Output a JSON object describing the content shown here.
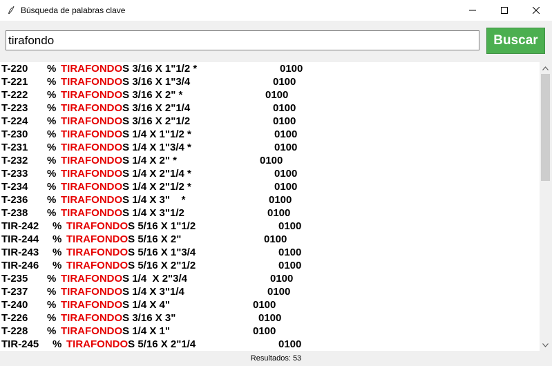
{
  "window": {
    "title": "Búsqueda de palabras clave",
    "app_icon": "feather-icon",
    "controls": [
      "minimize-icon",
      "maximize-icon",
      "close-icon"
    ]
  },
  "search": {
    "value": "tirafondo",
    "button_label": "Buscar",
    "button_color": "#4caf50"
  },
  "colors": {
    "keyword": "#e60000"
  },
  "results": [
    {
      "code": "T-220",
      "pct": "%",
      "kw": "TIRAFONDO",
      "rest": "S 3/16 X 1\"1/2 *",
      "qty": "0100"
    },
    {
      "code": "T-221",
      "pct": "%",
      "kw": "TIRAFONDO",
      "rest": "S 3/16 X 1\"3/4",
      "qty": "0100"
    },
    {
      "code": "T-222",
      "pct": "%",
      "kw": "TIRAFONDO",
      "rest": "S 3/16 X 2\" *",
      "qty": "0100"
    },
    {
      "code": "T-223",
      "pct": "%",
      "kw": "TIRAFONDO",
      "rest": "S 3/16 X 2\"1/4",
      "qty": "0100"
    },
    {
      "code": "T-224",
      "pct": "%",
      "kw": "TIRAFONDO",
      "rest": "S 3/16 X 2\"1/2",
      "qty": "0100"
    },
    {
      "code": "T-230",
      "pct": "%",
      "kw": "TIRAFONDO",
      "rest": "S 1/4 X 1\"1/2 *",
      "qty": "0100"
    },
    {
      "code": "T-231",
      "pct": "%",
      "kw": "TIRAFONDO",
      "rest": "S 1/4 X 1\"3/4 *",
      "qty": "0100"
    },
    {
      "code": "T-232",
      "pct": "%",
      "kw": "TIRAFONDO",
      "rest": "S 1/4 X 2\" *",
      "qty": "0100"
    },
    {
      "code": "T-233",
      "pct": "%",
      "kw": "TIRAFONDO",
      "rest": "S 1/4 X 2\"1/4 *",
      "qty": "0100"
    },
    {
      "code": "T-234",
      "pct": "%",
      "kw": "TIRAFONDO",
      "rest": "S 1/4 X 2\"1/2 *",
      "qty": "0100"
    },
    {
      "code": "T-236",
      "pct": "%",
      "kw": "TIRAFONDO",
      "rest": "S 1/4 X 3\"    *",
      "qty": "0100"
    },
    {
      "code": "T-238",
      "pct": "%",
      "kw": "TIRAFONDO",
      "rest": "S 1/4 X 3\"1/2",
      "qty": "0100"
    },
    {
      "code": "TIR-242",
      "pct": "%",
      "kw": "TIRAFONDO",
      "rest": "S 5/16 X 1\"1/2",
      "qty": "0100"
    },
    {
      "code": "TIR-244",
      "pct": "%",
      "kw": "TIRAFONDO",
      "rest": "S 5/16 X 2\"",
      "qty": "0100"
    },
    {
      "code": "TIR-243",
      "pct": "%",
      "kw": "TIRAFONDO",
      "rest": "S 5/16 X 1\"3/4",
      "qty": "0100"
    },
    {
      "code": "TIR-246",
      "pct": "%",
      "kw": "TIRAFONDO",
      "rest": "S 5/16 X 2\"1/2",
      "qty": "0100"
    },
    {
      "code": "T-235",
      "pct": "%",
      "kw": "TIRAFONDO",
      "rest": "S 1/4  X 2\"3/4",
      "qty": "0100"
    },
    {
      "code": "T-237",
      "pct": "%",
      "kw": "TIRAFONDO",
      "rest": "S 1/4 X 3\"1/4",
      "qty": "0100"
    },
    {
      "code": "T-240",
      "pct": "%",
      "kw": "TIRAFONDO",
      "rest": "S 1/4 X 4\"",
      "qty": "0100"
    },
    {
      "code": "T-226",
      "pct": "%",
      "kw": "TIRAFONDO",
      "rest": "S 3/16 X 3\"",
      "qty": "0100"
    },
    {
      "code": "T-228",
      "pct": "%",
      "kw": "TIRAFONDO",
      "rest": "S 1/4 X 1\"",
      "qty": "0100"
    },
    {
      "code": "TIR-245",
      "pct": "%",
      "kw": "TIRAFONDO",
      "rest": "S 5/16 X 2\"1/4",
      "qty": "0100"
    }
  ],
  "status": {
    "text": "Resultados: 53"
  }
}
